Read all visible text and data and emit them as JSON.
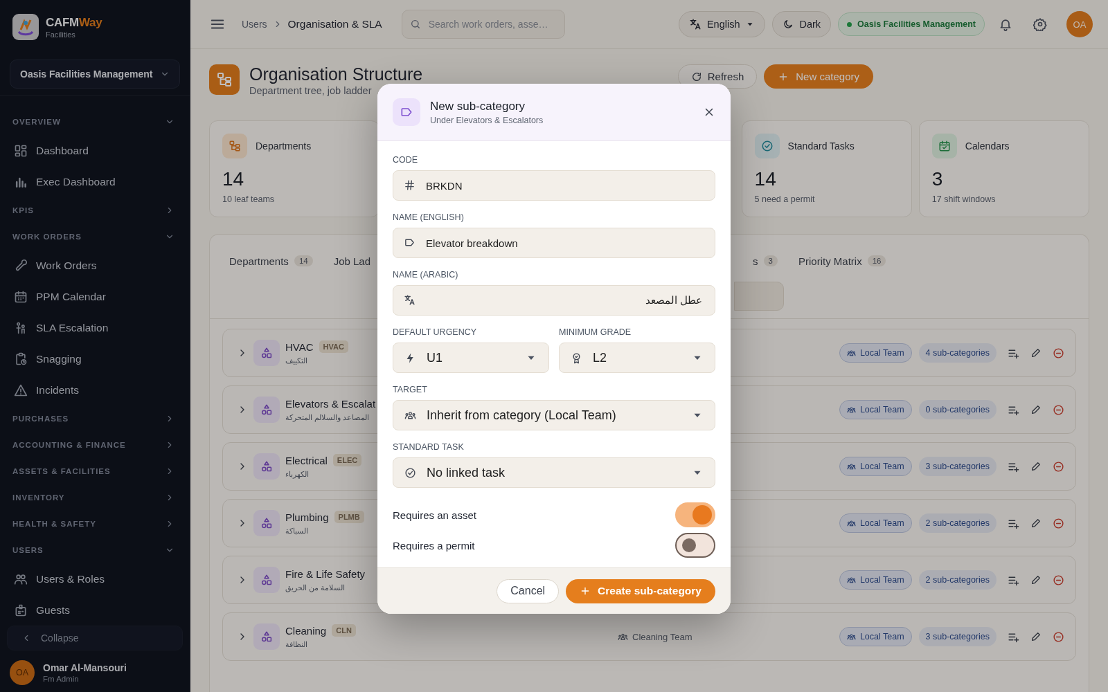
{
  "sidebar": {
    "brand": {
      "name": "CAFM",
      "accent": "Way",
      "subtitle": "Facilities"
    },
    "organisation": "Oasis Facilities Management",
    "sections": [
      {
        "label": "OVERVIEW",
        "expanded": true,
        "items": [
          {
            "label": "Dashboard"
          },
          {
            "label": "Exec Dashboard"
          }
        ]
      },
      {
        "label": "KPIS",
        "expanded": false
      },
      {
        "label": "WORK ORDERS",
        "expanded": true,
        "items": [
          {
            "label": "Work Orders"
          },
          {
            "label": "PPM Calendar"
          },
          {
            "label": "SLA Escalation"
          },
          {
            "label": "Snagging"
          },
          {
            "label": "Incidents"
          }
        ]
      },
      {
        "label": "PURCHASES",
        "expanded": false
      },
      {
        "label": "ACCOUNTING & FINANCE",
        "expanded": false
      },
      {
        "label": "ASSETS & FACILITIES",
        "expanded": false
      },
      {
        "label": "INVENTORY",
        "expanded": false
      },
      {
        "label": "HEALTH & SAFETY",
        "expanded": false
      },
      {
        "label": "USERS",
        "expanded": true,
        "items": [
          {
            "label": "Users & Roles"
          },
          {
            "label": "Guests"
          }
        ]
      }
    ],
    "collapse": "Collapse",
    "user": {
      "initials": "OA",
      "name": "Omar Al-Mansouri",
      "role": "Fm Admin"
    }
  },
  "topbar": {
    "breadcrumb": [
      "Users",
      "Organisation & SLA"
    ],
    "search": {
      "placeholder": "Search work orders, asse…"
    },
    "language": "English",
    "theme": "Dark",
    "tenant": "Oasis Facilities Management",
    "avatar": "OA"
  },
  "header": {
    "title": "Organisation Structure",
    "subtitle": "Department tree, job ladder",
    "refresh": "Refresh",
    "new_category": "New category"
  },
  "stats": [
    {
      "label": "Departments",
      "value": "14",
      "note": "10 leaf teams"
    },
    {
      "label": "Standard Tasks",
      "value": "14",
      "note": "5 need a permit"
    },
    {
      "label": "Calendars",
      "value": "3",
      "note": "17 shift windows"
    }
  ],
  "tabs": [
    {
      "label": "Departments",
      "count": "14",
      "selected": false
    },
    {
      "label": "Job Lad",
      "selected": false
    },
    {
      "label": "s",
      "count": "3",
      "selected": false
    },
    {
      "label": "Priority Matrix",
      "count": "16",
      "selected": false
    }
  ],
  "rows": [
    {
      "name": "HVAC",
      "code": "HVAC",
      "arabic": "التكييف",
      "team": "Local Team",
      "subcategories": "4 sub-categories"
    },
    {
      "name": "Elevators & Escalat",
      "arabic": "المصاعد والسلالم المتحركة",
      "team": "Local Team",
      "subcategories": "0 sub-categories"
    },
    {
      "name": "Electrical",
      "code": "ELEC",
      "arabic": "الكهرباء",
      "team": "Local Team",
      "subcategories": "3 sub-categories"
    },
    {
      "name": "Plumbing",
      "code": "PLMB",
      "arabic": "السباكة",
      "team": "Local Team",
      "subcategories": "2 sub-categories"
    },
    {
      "name": "Fire & Life Safety",
      "arabic": "السلامة من الحريق",
      "team": "Local Team",
      "subcategories": "2 sub-categories"
    },
    {
      "name": "Cleaning",
      "code": "CLN",
      "arabic": "النظافة",
      "assignee": "Cleaning Team",
      "team": "Local Team",
      "subcategories": "3 sub-categories"
    }
  ],
  "modal": {
    "title": "New sub-category",
    "subtitle": "Under Elevators & Escalators",
    "field_rows": [
      [
        {
          "kind": "text",
          "label": "CODE",
          "value": "BRKDN"
        }
      ],
      [
        {
          "kind": "text",
          "label": "NAME (ENGLISH)",
          "value": "Elevator breakdown"
        }
      ],
      [
        {
          "kind": "text",
          "label": "NAME (ARABIC)",
          "value": "عطل المصعد",
          "rtl": true
        }
      ],
      [
        {
          "kind": "select",
          "label": "DEFAULT URGENCY",
          "value": "U1"
        },
        {
          "kind": "select",
          "label": "MINIMUM GRADE",
          "value": "L2"
        }
      ],
      [
        {
          "kind": "select",
          "label": "TARGET",
          "value": "Inherit from category (Local Team)"
        }
      ],
      [
        {
          "kind": "select",
          "label": "STANDARD TASK",
          "value": "No linked task"
        }
      ]
    ],
    "toggles": [
      {
        "label": "Requires an asset",
        "on": true
      },
      {
        "label": "Requires a permit",
        "on": false
      }
    ],
    "cancel": "Cancel",
    "submit": "Create sub-category"
  }
}
